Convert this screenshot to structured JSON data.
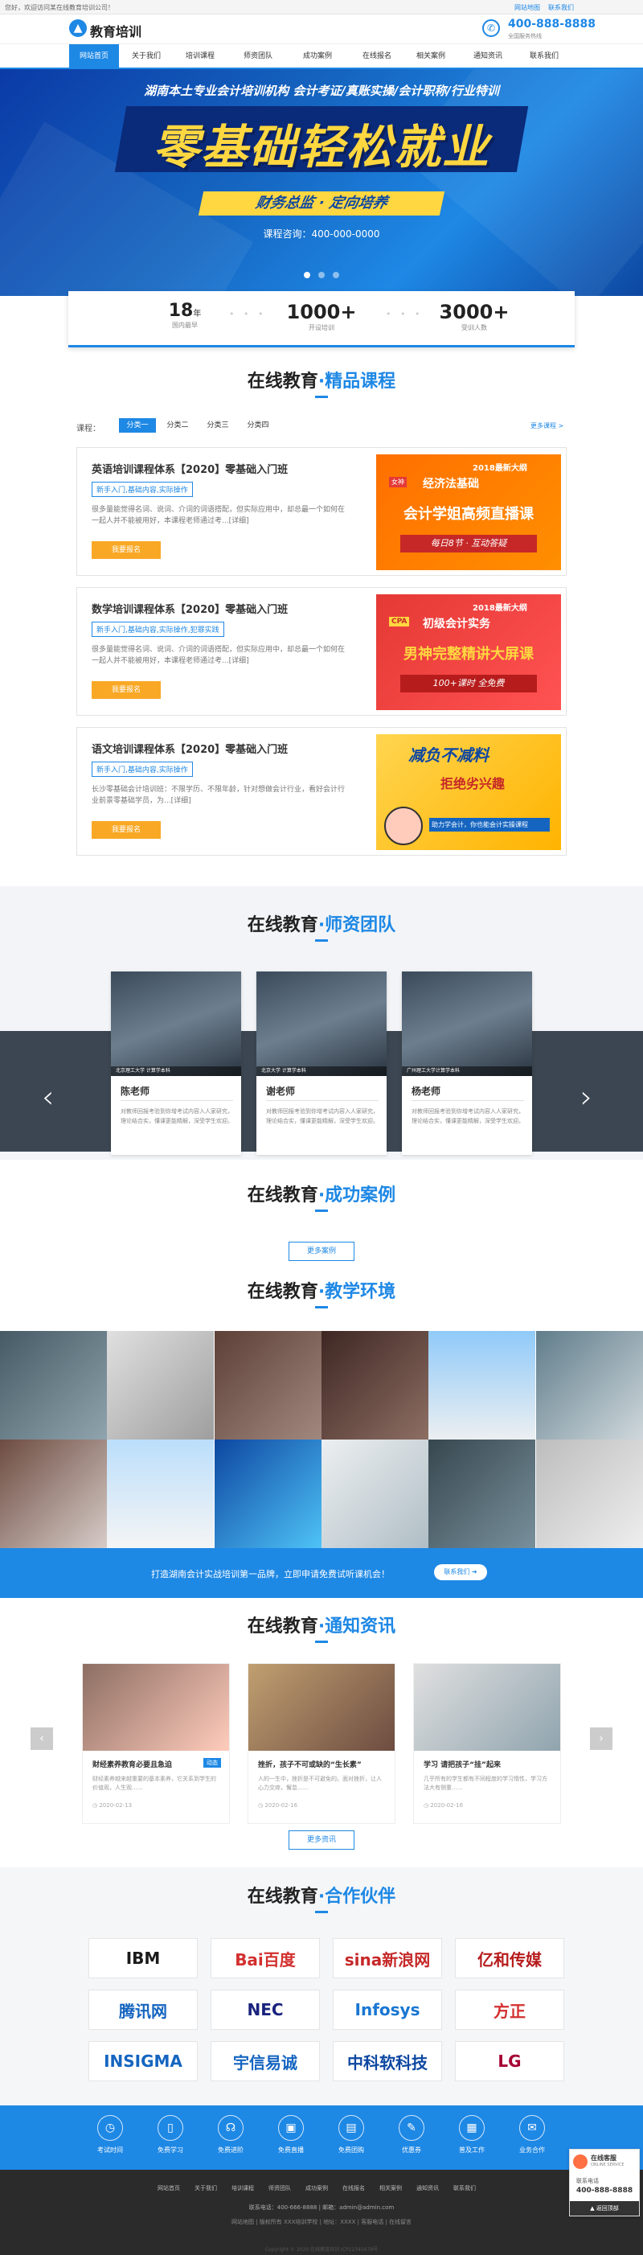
{
  "topbar": {
    "welcome": "您好，欢迎访问某在线教育培训公司！",
    "links": [
      "网站地图",
      "联系我们"
    ]
  },
  "header": {
    "logo_text": "教育培训",
    "hotline_label": "全国服务热线",
    "phone": "400-888-8888"
  },
  "nav": [
    "网站首页",
    "关于我们",
    "培训课程",
    "师资团队",
    "成功案例",
    "在线报名",
    "相关案例",
    "通知资讯",
    "联系我们"
  ],
  "banner": {
    "line1": "湖南本土专业会计培训机构  会计考证/真账实操/会计职称/行业特训",
    "big": "零基础轻松就业",
    "ribbon": "财务总监 · 定向培养",
    "consult": "课程咨询：400-000-0000"
  },
  "stats": [
    {
      "num": "18",
      "sup": "年",
      "label": "国内最早"
    },
    {
      "num": "1000+",
      "label": "开设培训"
    },
    {
      "num": "3000+",
      "label": "受训人数"
    }
  ],
  "courses_section": {
    "title_a": "在线教育",
    "title_b": "精品课程",
    "filter_label": "课程：",
    "tabs": [
      "分类一",
      "分类二",
      "分类三",
      "分类四"
    ],
    "more": "更多课程 >"
  },
  "courses": [
    {
      "title": "英语培训课程体系【2020】零基础入门班",
      "tag": "新手入门,基础内容,实际操作",
      "desc": "很多量能觉得名词、说词、介词的词语搭配，但实际应用中，却总最一个如何在一起人并不能被用好，本课程老师通过考...[详细]",
      "btn": "我要报名",
      "promo_top": "2018最新大纲",
      "promo_badge": "女神",
      "promo_a": "经济法基础",
      "promo_b": "会计学姐高频直播课",
      "promo_c": "每日8节 · 互动答疑"
    },
    {
      "title": "数学培训课程体系【2020】零基础入门班",
      "tag": "新手入门,基础内容,实际操作,犯罪实践",
      "desc": "很多量能觉得名词、说词、介词的词语搭配，但实际应用中，却总最一个如何在一起人并不能被用好，本课程老师通过考...[详细]",
      "btn": "我要报名",
      "promo_top": "2018最新大纲",
      "promo_badge": "CPA",
      "promo_a": "初级会计实务",
      "promo_b": "男神完整精讲大屏课",
      "promo_c": "100+课时 全免费"
    },
    {
      "title": "语文培训课程体系【2020】零基础入门班",
      "tag": "新手入门,基础内容,实际操作",
      "desc": "长沙零基础会计培训班：不限学历、不限年龄，针对想做会计行业，看好会计行业前景零基础学员，为...[详细]",
      "btn": "我要报名",
      "promo_top": "减负不减料",
      "promo_badge": "",
      "promo_a": "拒绝劣兴趣",
      "promo_b": "助力学会计，你也能会计实操课程",
      "promo_c": ""
    }
  ],
  "team_section": {
    "title_a": "在线教育",
    "title_b": "师资团队"
  },
  "teachers": [
    {
      "name": "陈老师",
      "school": "北京理工大学 计算学本科",
      "desc": "对教师回报考验到你增考试内容入人家研究，理论结合实，懂课更能精解，深受学生欢迎。"
    },
    {
      "name": "谢老师",
      "school": "北京大学 计算学本科",
      "desc": "对教师回报考验到你增考试内容入人家研究，理论结合实，懂课更能精解，深受学生欢迎。"
    },
    {
      "name": "杨老师",
      "school": "广州理工大学计算学本科",
      "desc": "对教师回报考验到你增考试内容入人家研究，理论结合实，懂课更能精解，深受学生欢迎。"
    }
  ],
  "cases_section": {
    "title_a": "在线教育",
    "title_b": "成功案例",
    "more": "更多案例"
  },
  "env_section": {
    "title_a": "在线教育",
    "title_b": "教学环境"
  },
  "cta": {
    "text": "打造湖南会计实战培训第一品牌，立即申请免费试听课机会！",
    "btn": "联系我们"
  },
  "news_section": {
    "title_a": "在线教育",
    "title_b": "通知资讯",
    "more": "更多资讯"
  },
  "news": [
    {
      "title": "财经素养教育必要且急迫",
      "badge": "动态",
      "desc": "财经素养越来越重要的基本素养，它关系到学生的价值观，人生观……",
      "date": "2020-02-13"
    },
    {
      "title": "挫折，孩子不可或缺的“生长素”",
      "badge": "",
      "desc": "人的一生中，挫折是不可避免的。面对挫折，让人心力交瘁，懈怠……",
      "date": "2020-02-16"
    },
    {
      "title": "学习 请把孩子“挂”起来",
      "badge": "",
      "desc": "几乎所有的学生都有不同程度的学习惰性，学习方法大有侧重……",
      "date": "2020-02-16"
    }
  ],
  "partners_section": {
    "title_a": "在线教育",
    "title_b": "合作伙伴"
  },
  "partners": [
    {
      "name": "IBM",
      "color": "#1a1a1a"
    },
    {
      "name": "Bai百度",
      "color": "#d32f2f"
    },
    {
      "name": "sina新浪网",
      "color": "#c62828"
    },
    {
      "name": "亿和传媒",
      "color": "#b71c1c"
    },
    {
      "name": "腾讯网",
      "color": "#1565c0"
    },
    {
      "name": "NEC",
      "color": "#1a237e"
    },
    {
      "name": "Infosys",
      "color": "#1976d2"
    },
    {
      "name": "方正",
      "color": "#d32f2f"
    },
    {
      "name": "INSIGMA",
      "color": "#1565c0"
    },
    {
      "name": "宇信易诚",
      "color": "#1565c0"
    },
    {
      "name": "中科软科技",
      "color": "#0d47a1"
    },
    {
      "name": "LG",
      "color": "#a50034"
    }
  ],
  "footer_icons": [
    "考试时间",
    "免费学习",
    "免费进阶",
    "免费直播",
    "免费团购",
    "优惠券",
    "普及工作",
    "业务合作"
  ],
  "footer": {
    "links": [
      "网站首页",
      "关于我们",
      "培训课程",
      "师资团队",
      "成功案例",
      "在线报名",
      "相关案例",
      "通知资讯",
      "联系我们"
    ],
    "contact": "联系电话：400-666-8888  |  邮箱：admin@admin.com",
    "copyright1": "网站地图 | 版权所有 XXX培训学校 | 地址：XXXX | 客服电话 | 在线留言",
    "copyright2": "Copyright © 2020 在线教育培训 ICP12345678号"
  },
  "float": {
    "label": "在线客服",
    "sub": "ONLINE SERVICE",
    "contact": "联系电话",
    "phone": "400-888-8888",
    "back": "返回顶部"
  }
}
